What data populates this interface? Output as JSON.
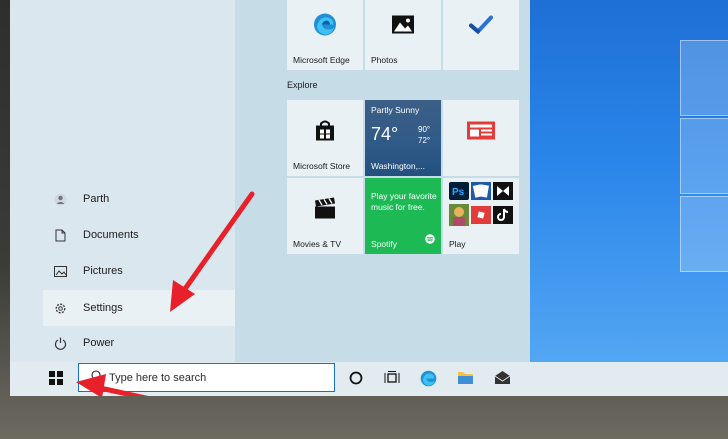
{
  "start_menu": {
    "user_label": "Parth",
    "items": [
      {
        "label": "Documents"
      },
      {
        "label": "Pictures"
      },
      {
        "label": "Settings"
      },
      {
        "label": "Power"
      }
    ]
  },
  "tiles": {
    "edge": "Microsoft Edge",
    "photos": "Photos",
    "section": "Explore",
    "store": "Microsoft Store",
    "weather": {
      "condition": "Partly Sunny",
      "temp": "74°",
      "high": "90°",
      "low": "72°",
      "location": "Washington,..."
    },
    "movies": "Movies & TV",
    "spotify": {
      "text": "Play your favorite music for free.",
      "label": "Spotify"
    },
    "play": "Play"
  },
  "taskbar": {
    "search_placeholder": "Type here to search"
  },
  "colors": {
    "accent": "#1a6ec3",
    "spotify": "#1db954",
    "desktop": "#2a86ea"
  }
}
